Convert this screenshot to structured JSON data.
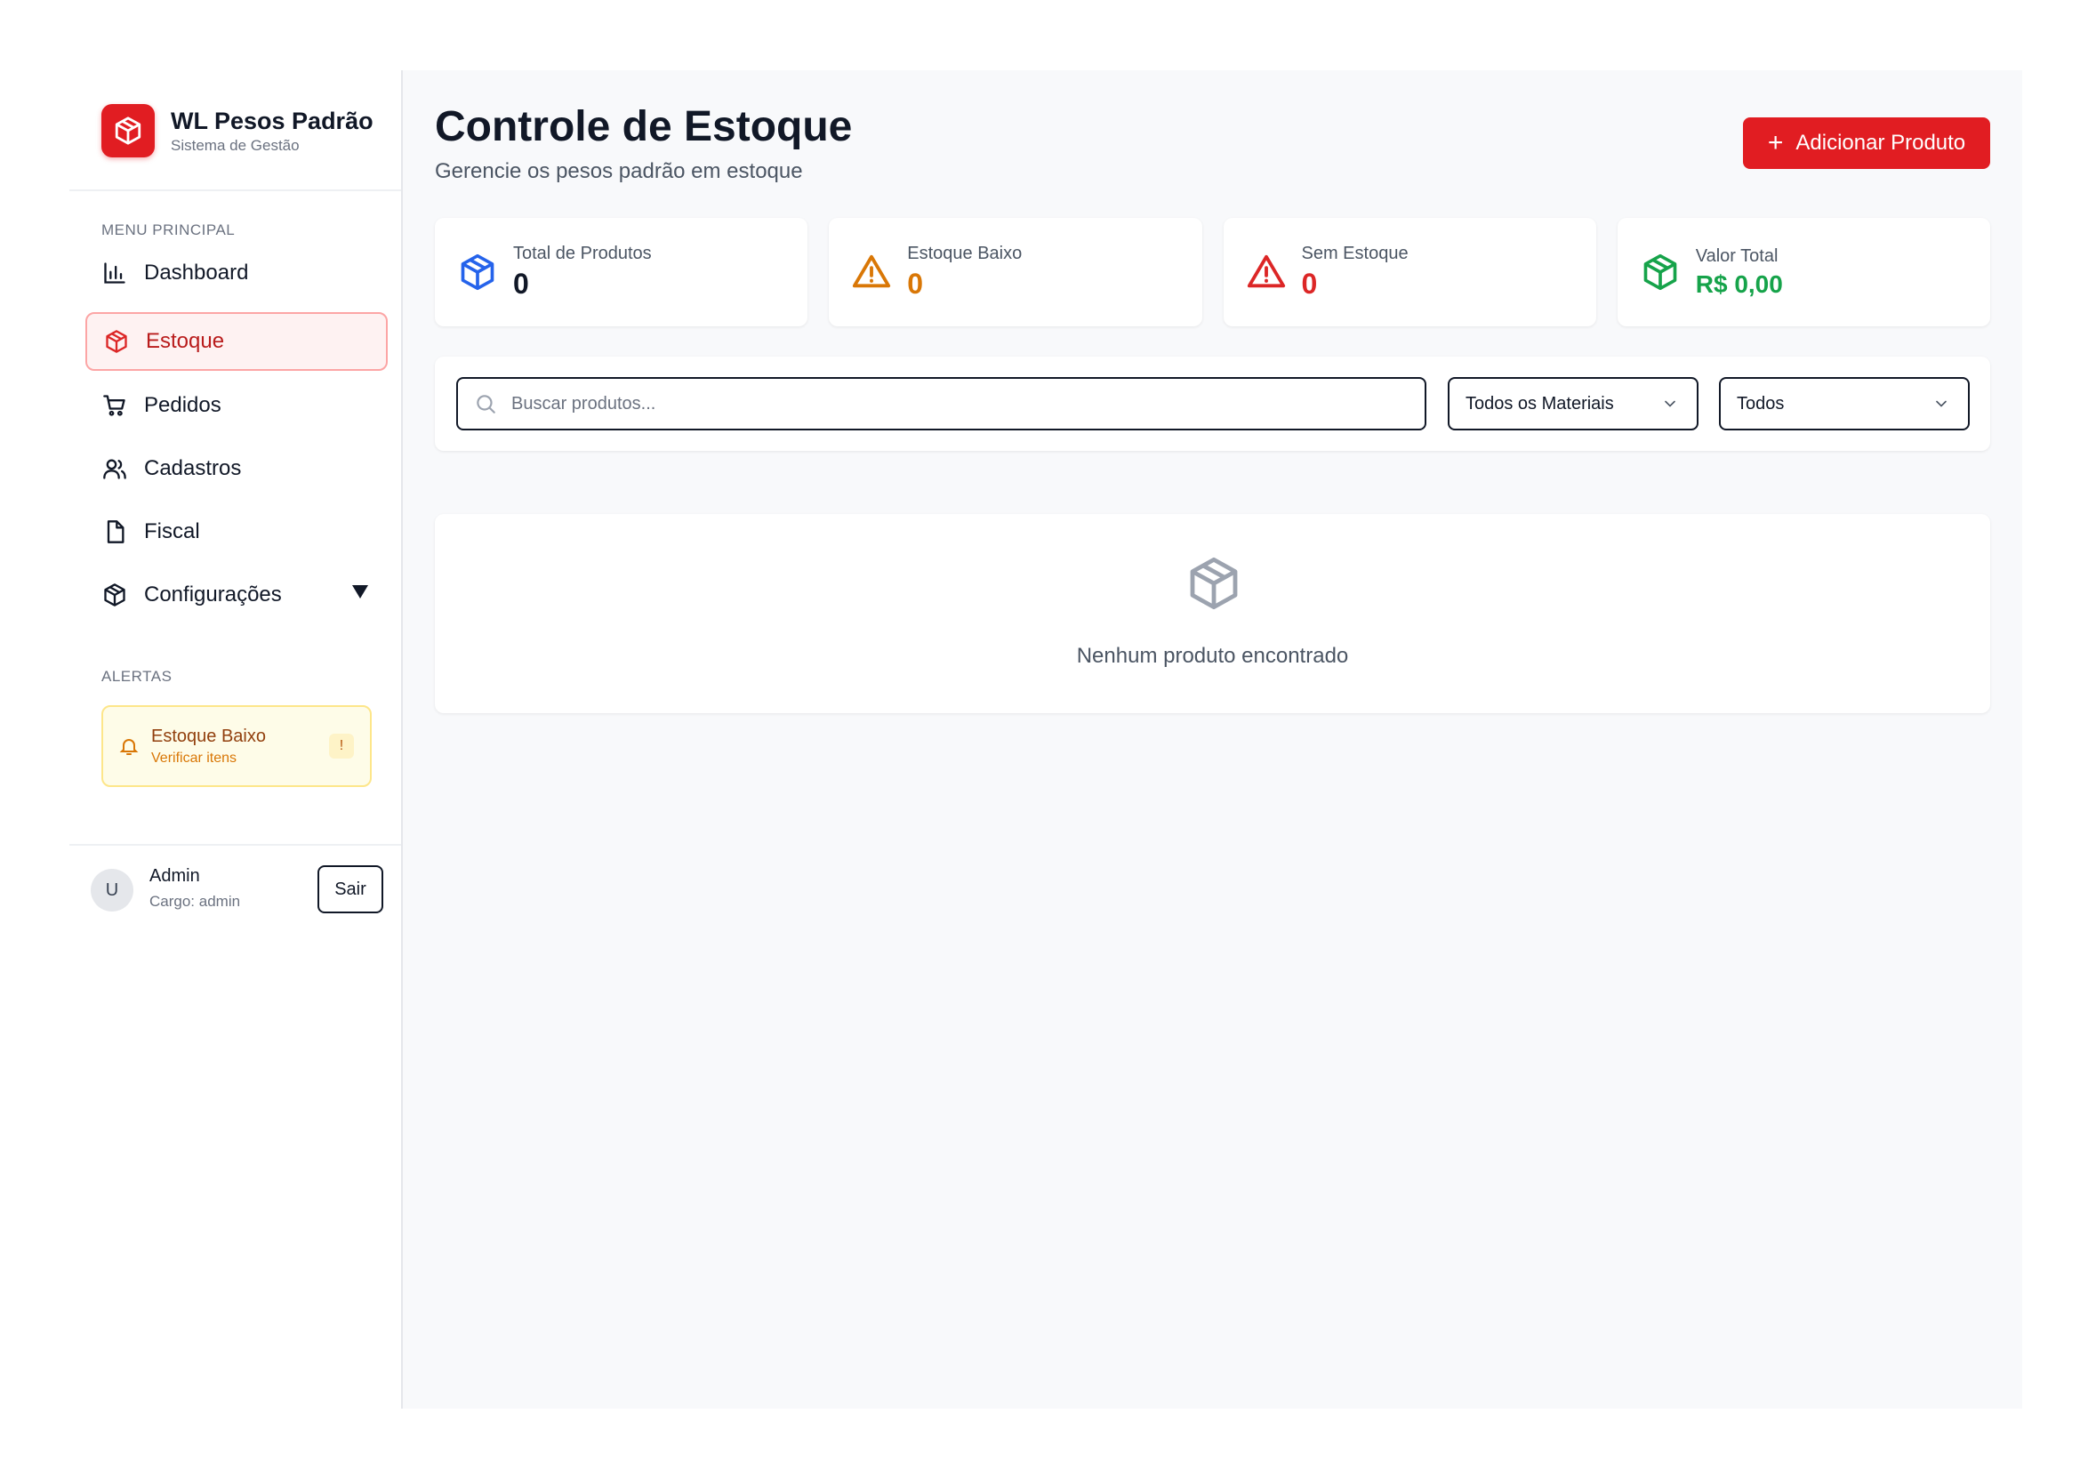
{
  "brand": {
    "name": "WL Pesos Padrão",
    "subtitle": "Sistema de Gestão"
  },
  "sidebar": {
    "menu_label": "MENU PRINCIPAL",
    "items": [
      {
        "label": "Dashboard",
        "icon": "bar-chart-icon",
        "active": false
      },
      {
        "label": "Estoque",
        "icon": "box-icon",
        "active": true
      },
      {
        "label": "Pedidos",
        "icon": "cart-icon",
        "active": false
      },
      {
        "label": "Cadastros",
        "icon": "users-icon",
        "active": false
      },
      {
        "label": "Fiscal",
        "icon": "document-icon",
        "active": false
      },
      {
        "label": "Configurações",
        "icon": "box-icon",
        "active": false,
        "expandable": true
      }
    ],
    "alerts_label": "ALERTAS",
    "alert": {
      "title": "Estoque Baixo",
      "subtitle": "Verificar itens",
      "badge": "!"
    },
    "user": {
      "avatar": "U",
      "name": "Admin",
      "role": "Cargo: admin",
      "logout_label": "Sair"
    }
  },
  "header": {
    "title": "Controle de Estoque",
    "subtitle": "Gerencie os pesos padrão em estoque",
    "add_button": "Adicionar Produto"
  },
  "stats": [
    {
      "label": "Total de Produtos",
      "value": "0",
      "color": "#111827",
      "icon": "box-icon",
      "icon_color": "#2563eb"
    },
    {
      "label": "Estoque Baixo",
      "value": "0",
      "color": "#d97706",
      "icon": "warning-icon",
      "icon_color": "#d97706"
    },
    {
      "label": "Sem Estoque",
      "value": "0",
      "color": "#dc2626",
      "icon": "warning-icon",
      "icon_color": "#dc2626"
    },
    {
      "label": "Valor Total",
      "value": "R$ 0,00",
      "color": "#16a34a",
      "icon": "box-icon",
      "icon_color": "#16a34a"
    }
  ],
  "filters": {
    "search_placeholder": "Buscar produtos...",
    "material_select": "Todos os Materiais",
    "status_select": "Todos"
  },
  "empty_state": {
    "message": "Nenhum produto encontrado"
  },
  "colors": {
    "accent": "#e11d22",
    "background": "#f8f9fb"
  }
}
